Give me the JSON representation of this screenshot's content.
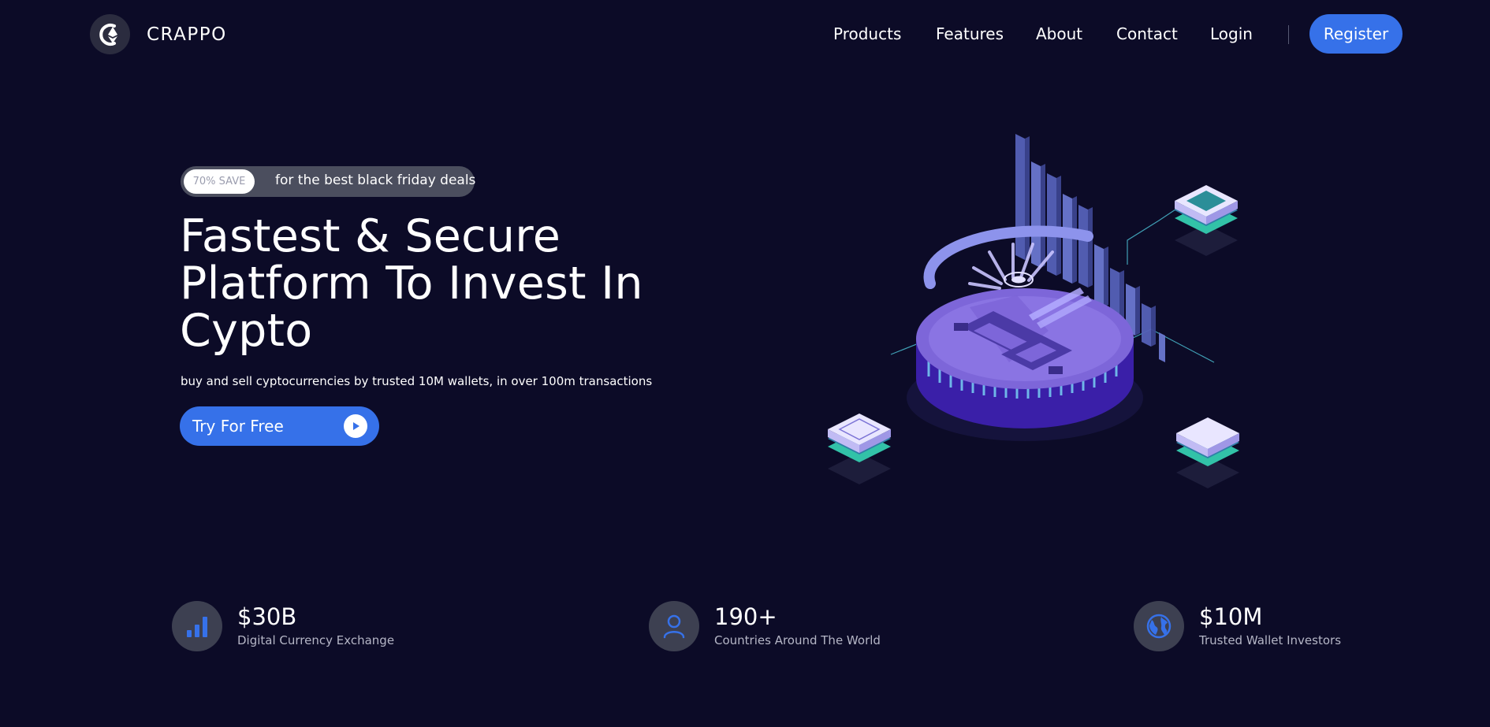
{
  "brand": {
    "name": "CRAPPO",
    "logo_icon": "ethereum-logo-icon"
  },
  "nav": {
    "links": [
      "Products",
      "Features",
      "About",
      "Contact",
      "Login"
    ],
    "register_label": "Register"
  },
  "hero": {
    "badge_pill": "70% SAVE",
    "badge_text": "for the best black friday deals",
    "title_lines": [
      "Fastest & Secure",
      "Platform To Invest In",
      "Cypto"
    ],
    "subtitle": "buy and sell cyptocurrencies by trusted 10M wallets, in over 100m transactions",
    "cta_label": "Try For Free",
    "cta_icon": "play-icon"
  },
  "stats": [
    {
      "value": "$30B",
      "label": "Digital Currency Exchange",
      "icon": "bar-chart-icon"
    },
    {
      "value": "190+",
      "label": "Countries Around The World",
      "icon": "user-icon"
    },
    {
      "value": "$10M",
      "label": "Trusted Wallet Investors",
      "icon": "globe-icon"
    }
  ],
  "colors": {
    "background": "#0c0b27",
    "accent": "#3671e9",
    "coin": "#7d66d9",
    "badge_bg": "#4b4e5e"
  }
}
